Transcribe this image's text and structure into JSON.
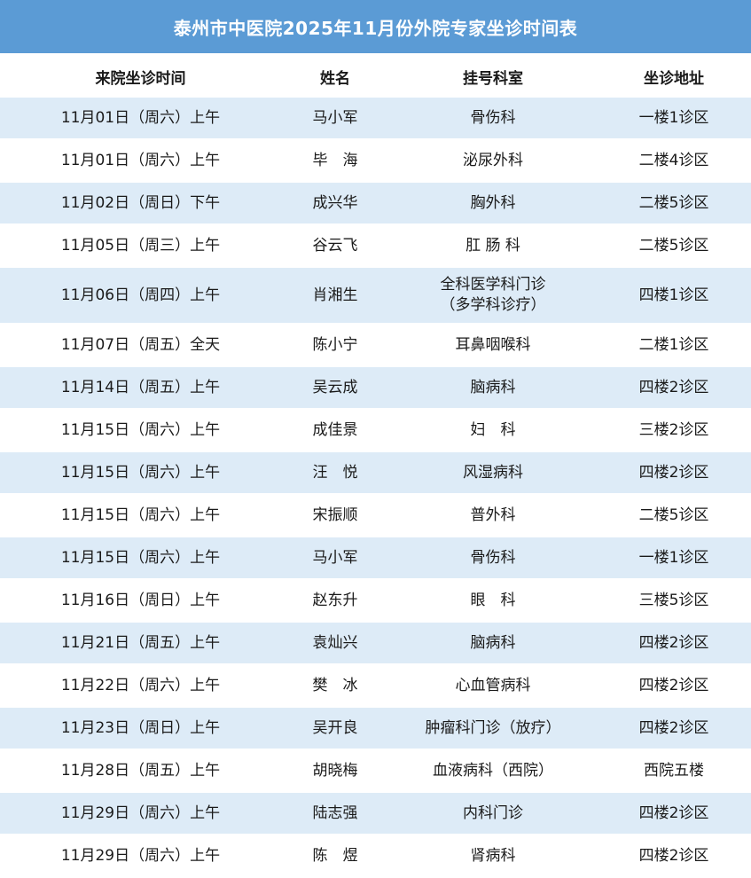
{
  "title": "泰州市中医院2025年11月份外院专家坐诊时间表",
  "headers": [
    "来院坐诊时间",
    "姓名",
    "挂号科室",
    "坐诊地址"
  ],
  "rows": [
    {
      "time": "11月01日（周六）上午",
      "name": "马小军",
      "dept": "骨伤科",
      "dept2": "",
      "loc": "一楼1诊区"
    },
    {
      "time": "11月01日（周六）上午",
      "name": "毕　海",
      "dept": "泌尿外科",
      "dept2": "",
      "loc": "二楼4诊区"
    },
    {
      "time": "11月02日（周日）下午",
      "name": "成兴华",
      "dept": "胸外科",
      "dept2": "",
      "loc": "二楼5诊区"
    },
    {
      "time": "11月05日（周三）上午",
      "name": "谷云飞",
      "dept": "肛 肠 科",
      "dept2": "",
      "loc": "二楼5诊区"
    },
    {
      "time": "11月06日（周四）上午",
      "name": "肖湘生",
      "dept": "全科医学科门诊",
      "dept2": "（多学科诊疗）",
      "loc": "四楼1诊区"
    },
    {
      "time": "11月07日（周五）全天",
      "name": "陈小宁",
      "dept": "耳鼻咽喉科",
      "dept2": "",
      "loc": "二楼1诊区"
    },
    {
      "time": "11月14日（周五）上午",
      "name": "吴云成",
      "dept": "脑病科",
      "dept2": "",
      "loc": "四楼2诊区"
    },
    {
      "time": "11月15日（周六）上午",
      "name": "成佳景",
      "dept": "妇　科",
      "dept2": "",
      "loc": "三楼2诊区"
    },
    {
      "time": "11月15日（周六）上午",
      "name": "汪　悦",
      "dept": "风湿病科",
      "dept2": "",
      "loc": "四楼2诊区"
    },
    {
      "time": "11月15日（周六）上午",
      "name": "宋振顺",
      "dept": "普外科",
      "dept2": "",
      "loc": "二楼5诊区"
    },
    {
      "time": "11月15日（周六）上午",
      "name": "马小军",
      "dept": "骨伤科",
      "dept2": "",
      "loc": "一楼1诊区"
    },
    {
      "time": "11月16日（周日）上午",
      "name": "赵东升",
      "dept": "眼　科",
      "dept2": "",
      "loc": "三楼5诊区"
    },
    {
      "time": "11月21日（周五）上午",
      "name": "袁灿兴",
      "dept": "脑病科",
      "dept2": "",
      "loc": "四楼2诊区"
    },
    {
      "time": "11月22日（周六）上午",
      "name": "樊　冰",
      "dept": "心血管病科",
      "dept2": "",
      "loc": "四楼2诊区"
    },
    {
      "time": "11月23日（周日）上午",
      "name": "吴开良",
      "dept": "肿瘤科门诊（放疗）",
      "dept2": "",
      "loc": "四楼2诊区"
    },
    {
      "time": "11月28日（周五）上午",
      "name": "胡晓梅",
      "dept": "血液病科（西院）",
      "dept2": "",
      "loc": "西院五楼"
    },
    {
      "time": "11月29日（周六）上午",
      "name": "陆志强",
      "dept": "内科门诊",
      "dept2": "",
      "loc": "四楼2诊区"
    },
    {
      "time": "11月29日（周六）上午",
      "name": "陈　煜",
      "dept": "肾病科",
      "dept2": "",
      "loc": "四楼2诊区"
    }
  ]
}
